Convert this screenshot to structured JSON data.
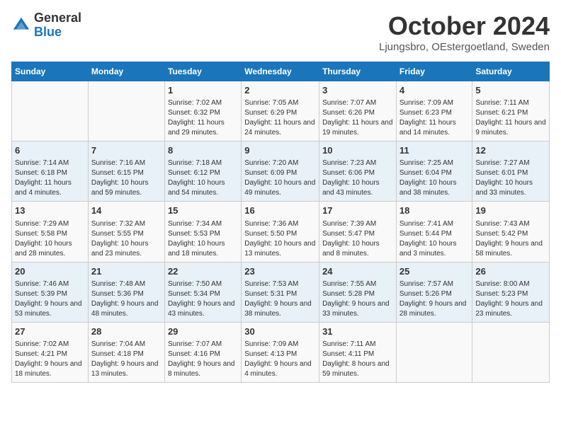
{
  "header": {
    "logo_general": "General",
    "logo_blue": "Blue",
    "month_title": "October 2024",
    "location": "Ljungsbro, OEstergoetland, Sweden"
  },
  "days_of_week": [
    "Sunday",
    "Monday",
    "Tuesday",
    "Wednesday",
    "Thursday",
    "Friday",
    "Saturday"
  ],
  "weeks": [
    [
      {
        "day": "",
        "info": ""
      },
      {
        "day": "",
        "info": ""
      },
      {
        "day": "1",
        "info": "Sunrise: 7:02 AM\nSunset: 6:32 PM\nDaylight: 11 hours and 29 minutes."
      },
      {
        "day": "2",
        "info": "Sunrise: 7:05 AM\nSunset: 6:29 PM\nDaylight: 11 hours and 24 minutes."
      },
      {
        "day": "3",
        "info": "Sunrise: 7:07 AM\nSunset: 6:26 PM\nDaylight: 11 hours and 19 minutes."
      },
      {
        "day": "4",
        "info": "Sunrise: 7:09 AM\nSunset: 6:23 PM\nDaylight: 11 hours and 14 minutes."
      },
      {
        "day": "5",
        "info": "Sunrise: 7:11 AM\nSunset: 6:21 PM\nDaylight: 11 hours and 9 minutes."
      }
    ],
    [
      {
        "day": "6",
        "info": "Sunrise: 7:14 AM\nSunset: 6:18 PM\nDaylight: 11 hours and 4 minutes."
      },
      {
        "day": "7",
        "info": "Sunrise: 7:16 AM\nSunset: 6:15 PM\nDaylight: 10 hours and 59 minutes."
      },
      {
        "day": "8",
        "info": "Sunrise: 7:18 AM\nSunset: 6:12 PM\nDaylight: 10 hours and 54 minutes."
      },
      {
        "day": "9",
        "info": "Sunrise: 7:20 AM\nSunset: 6:09 PM\nDaylight: 10 hours and 49 minutes."
      },
      {
        "day": "10",
        "info": "Sunrise: 7:23 AM\nSunset: 6:06 PM\nDaylight: 10 hours and 43 minutes."
      },
      {
        "day": "11",
        "info": "Sunrise: 7:25 AM\nSunset: 6:04 PM\nDaylight: 10 hours and 38 minutes."
      },
      {
        "day": "12",
        "info": "Sunrise: 7:27 AM\nSunset: 6:01 PM\nDaylight: 10 hours and 33 minutes."
      }
    ],
    [
      {
        "day": "13",
        "info": "Sunrise: 7:29 AM\nSunset: 5:58 PM\nDaylight: 10 hours and 28 minutes."
      },
      {
        "day": "14",
        "info": "Sunrise: 7:32 AM\nSunset: 5:55 PM\nDaylight: 10 hours and 23 minutes."
      },
      {
        "day": "15",
        "info": "Sunrise: 7:34 AM\nSunset: 5:53 PM\nDaylight: 10 hours and 18 minutes."
      },
      {
        "day": "16",
        "info": "Sunrise: 7:36 AM\nSunset: 5:50 PM\nDaylight: 10 hours and 13 minutes."
      },
      {
        "day": "17",
        "info": "Sunrise: 7:39 AM\nSunset: 5:47 PM\nDaylight: 10 hours and 8 minutes."
      },
      {
        "day": "18",
        "info": "Sunrise: 7:41 AM\nSunset: 5:44 PM\nDaylight: 10 hours and 3 minutes."
      },
      {
        "day": "19",
        "info": "Sunrise: 7:43 AM\nSunset: 5:42 PM\nDaylight: 9 hours and 58 minutes."
      }
    ],
    [
      {
        "day": "20",
        "info": "Sunrise: 7:46 AM\nSunset: 5:39 PM\nDaylight: 9 hours and 53 minutes."
      },
      {
        "day": "21",
        "info": "Sunrise: 7:48 AM\nSunset: 5:36 PM\nDaylight: 9 hours and 48 minutes."
      },
      {
        "day": "22",
        "info": "Sunrise: 7:50 AM\nSunset: 5:34 PM\nDaylight: 9 hours and 43 minutes."
      },
      {
        "day": "23",
        "info": "Sunrise: 7:53 AM\nSunset: 5:31 PM\nDaylight: 9 hours and 38 minutes."
      },
      {
        "day": "24",
        "info": "Sunrise: 7:55 AM\nSunset: 5:28 PM\nDaylight: 9 hours and 33 minutes."
      },
      {
        "day": "25",
        "info": "Sunrise: 7:57 AM\nSunset: 5:26 PM\nDaylight: 9 hours and 28 minutes."
      },
      {
        "day": "26",
        "info": "Sunrise: 8:00 AM\nSunset: 5:23 PM\nDaylight: 9 hours and 23 minutes."
      }
    ],
    [
      {
        "day": "27",
        "info": "Sunrise: 7:02 AM\nSunset: 4:21 PM\nDaylight: 9 hours and 18 minutes."
      },
      {
        "day": "28",
        "info": "Sunrise: 7:04 AM\nSunset: 4:18 PM\nDaylight: 9 hours and 13 minutes."
      },
      {
        "day": "29",
        "info": "Sunrise: 7:07 AM\nSunset: 4:16 PM\nDaylight: 9 hours and 8 minutes."
      },
      {
        "day": "30",
        "info": "Sunrise: 7:09 AM\nSunset: 4:13 PM\nDaylight: 9 hours and 4 minutes."
      },
      {
        "day": "31",
        "info": "Sunrise: 7:11 AM\nSunset: 4:11 PM\nDaylight: 8 hours and 59 minutes."
      },
      {
        "day": "",
        "info": ""
      },
      {
        "day": "",
        "info": ""
      }
    ]
  ]
}
